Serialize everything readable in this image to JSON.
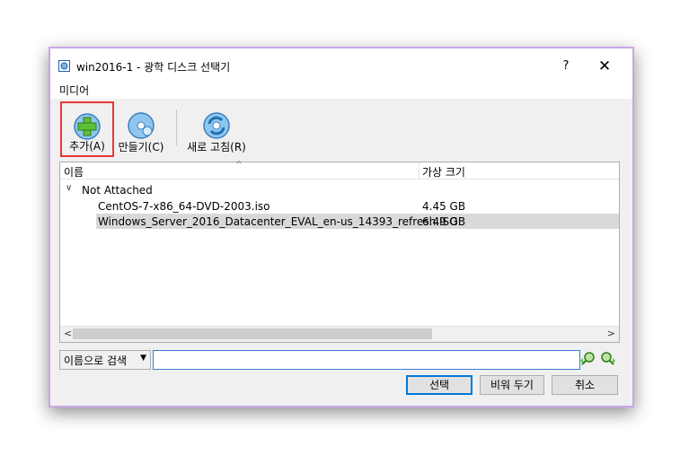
{
  "window": {
    "title": "win2016-1 - 광학 디스크 선택기",
    "help_label": "?",
    "close_label": "✕"
  },
  "menu": {
    "items": [
      "미디어"
    ]
  },
  "toolbar": {
    "add_label": "추가(A)",
    "create_label": "만들기(C)",
    "refresh_label": "새로 고침(R)"
  },
  "tree": {
    "columns": [
      "이름",
      "가상 크기"
    ],
    "group": "Not Attached",
    "rows": [
      {
        "name": "CentOS-7-x86_64-DVD-2003.iso",
        "size": "4.45 GB"
      },
      {
        "name": "Windows_Server_2016_Datacenter_EVAL_en-us_14393_refresh.ISO",
        "size": "6.49 GB"
      }
    ]
  },
  "search": {
    "mode": "이름으로 검색",
    "value": ""
  },
  "buttons": {
    "select": "선택",
    "leave_empty": "비워 두기",
    "cancel": "취소"
  },
  "colors": {
    "highlight": "#e53935",
    "selected_row": "#d9d9d9",
    "focus": "#0078d7"
  }
}
